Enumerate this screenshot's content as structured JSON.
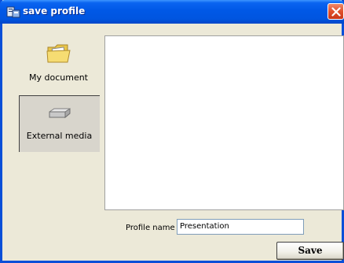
{
  "window": {
    "title": "save profile",
    "app_icon": "app-window-icon",
    "close_icon": "close-icon"
  },
  "sidebar": {
    "items": [
      {
        "label": "My document",
        "icon": "folder-icon",
        "selected": false
      },
      {
        "label": "External media",
        "icon": "drive-icon",
        "selected": true
      }
    ]
  },
  "form": {
    "profile_name_label": "Profile name",
    "profile_name_value": "Presentation",
    "save_label": "Save"
  },
  "colors": {
    "titlebar": "#0058e6",
    "window_bg": "#ece9d8",
    "close_button": "#e0502c",
    "selected_item_bg": "#d8d5cc"
  }
}
